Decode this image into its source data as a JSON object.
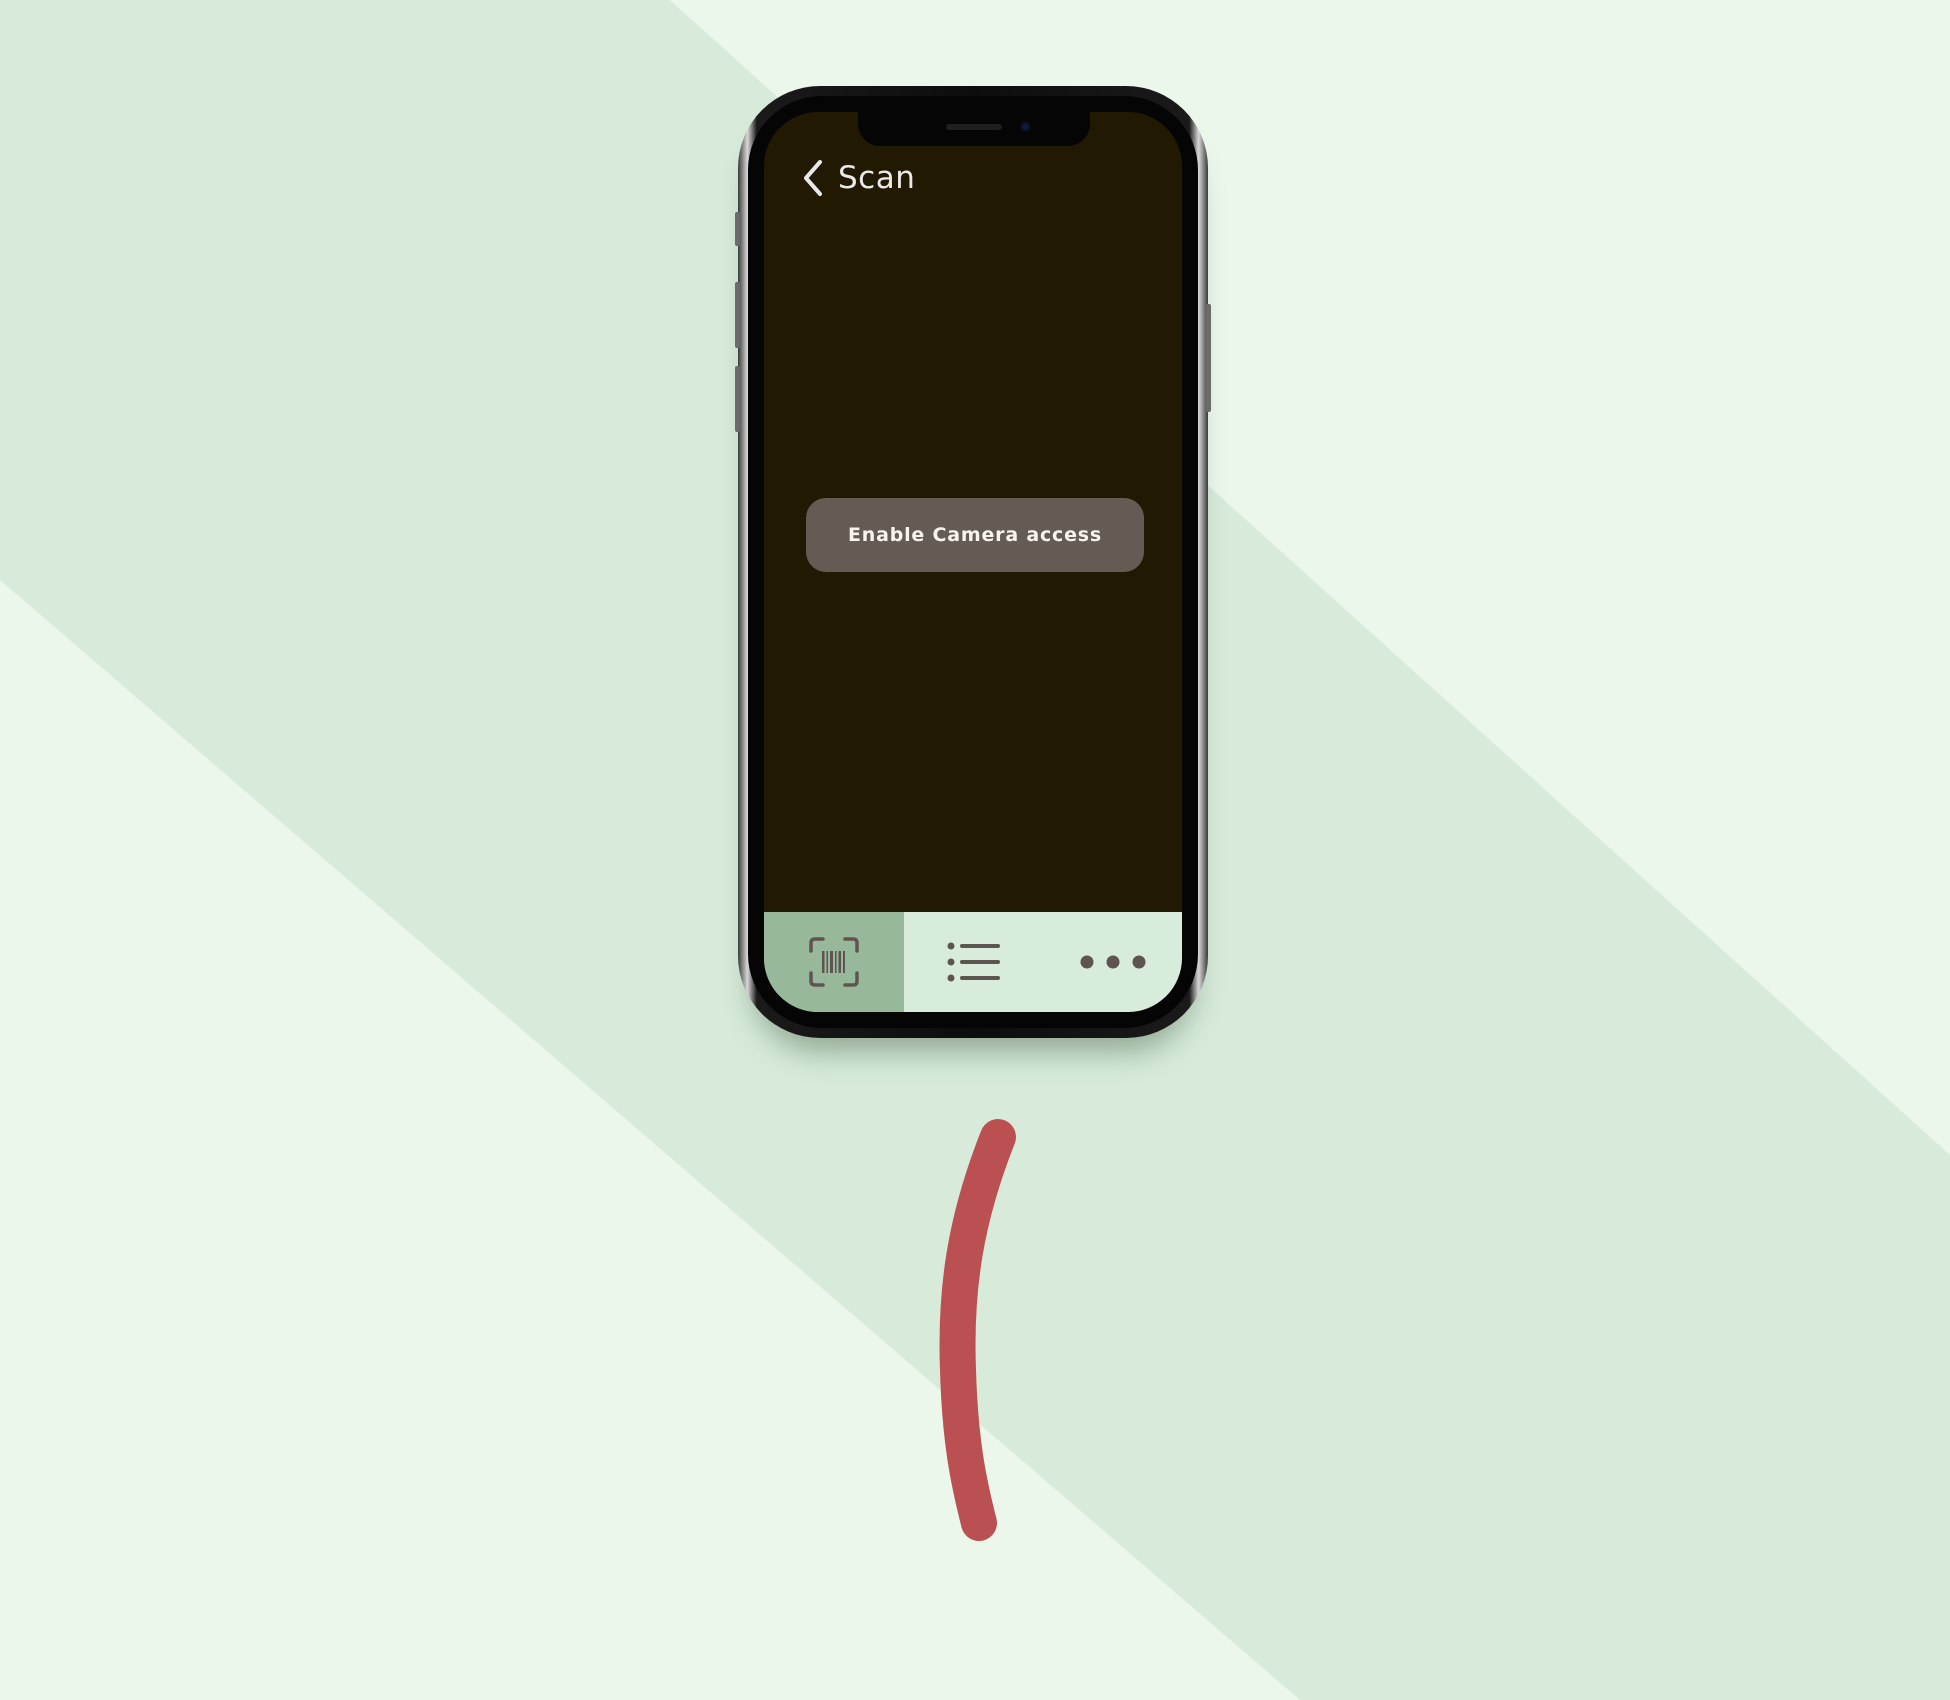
{
  "colors": {
    "background_light": "#ecf7ec",
    "background_band": "#d8ebdb",
    "screen_background": "#221903",
    "button_background": "#655b55",
    "tabbar_background": "#d8ecdb",
    "tab_active_background": "#97b89b",
    "icon_color": "#5f5550",
    "annotation_stroke": "#bb5052"
  },
  "nav": {
    "back_icon": "chevron-left-icon",
    "title": "Scan"
  },
  "main": {
    "enable_camera_label": "Enable Camera access"
  },
  "tabbar": {
    "tabs": [
      {
        "icon": "barcode-scan-icon",
        "active": true
      },
      {
        "icon": "list-icon",
        "active": false
      },
      {
        "icon": "more-dots-icon",
        "active": false
      }
    ]
  }
}
